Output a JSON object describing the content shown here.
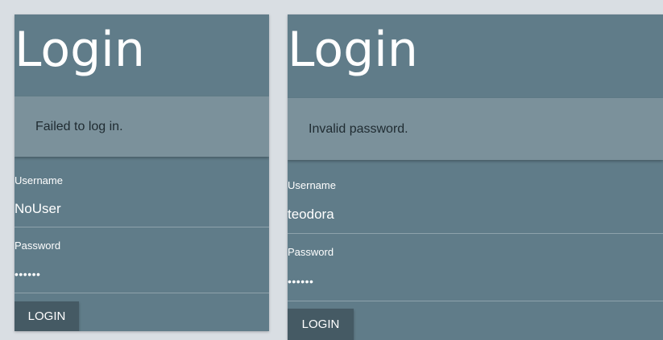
{
  "panels": [
    {
      "title": "Login",
      "alert": "Failed to log in.",
      "username_label": "Username",
      "username_value": "NoUser",
      "password_label": "Password",
      "password_value": "••••••",
      "login_label": "LOGIN"
    },
    {
      "title": "Login",
      "alert": "Invalid password.",
      "username_label": "Username",
      "username_value": "teodora",
      "password_label": "Password",
      "password_value": "••••••",
      "login_label": "LOGIN"
    }
  ],
  "colors": {
    "background": "#d9dee3",
    "panel": "#607c89",
    "alert": "#7b919b",
    "button": "#455a64"
  }
}
